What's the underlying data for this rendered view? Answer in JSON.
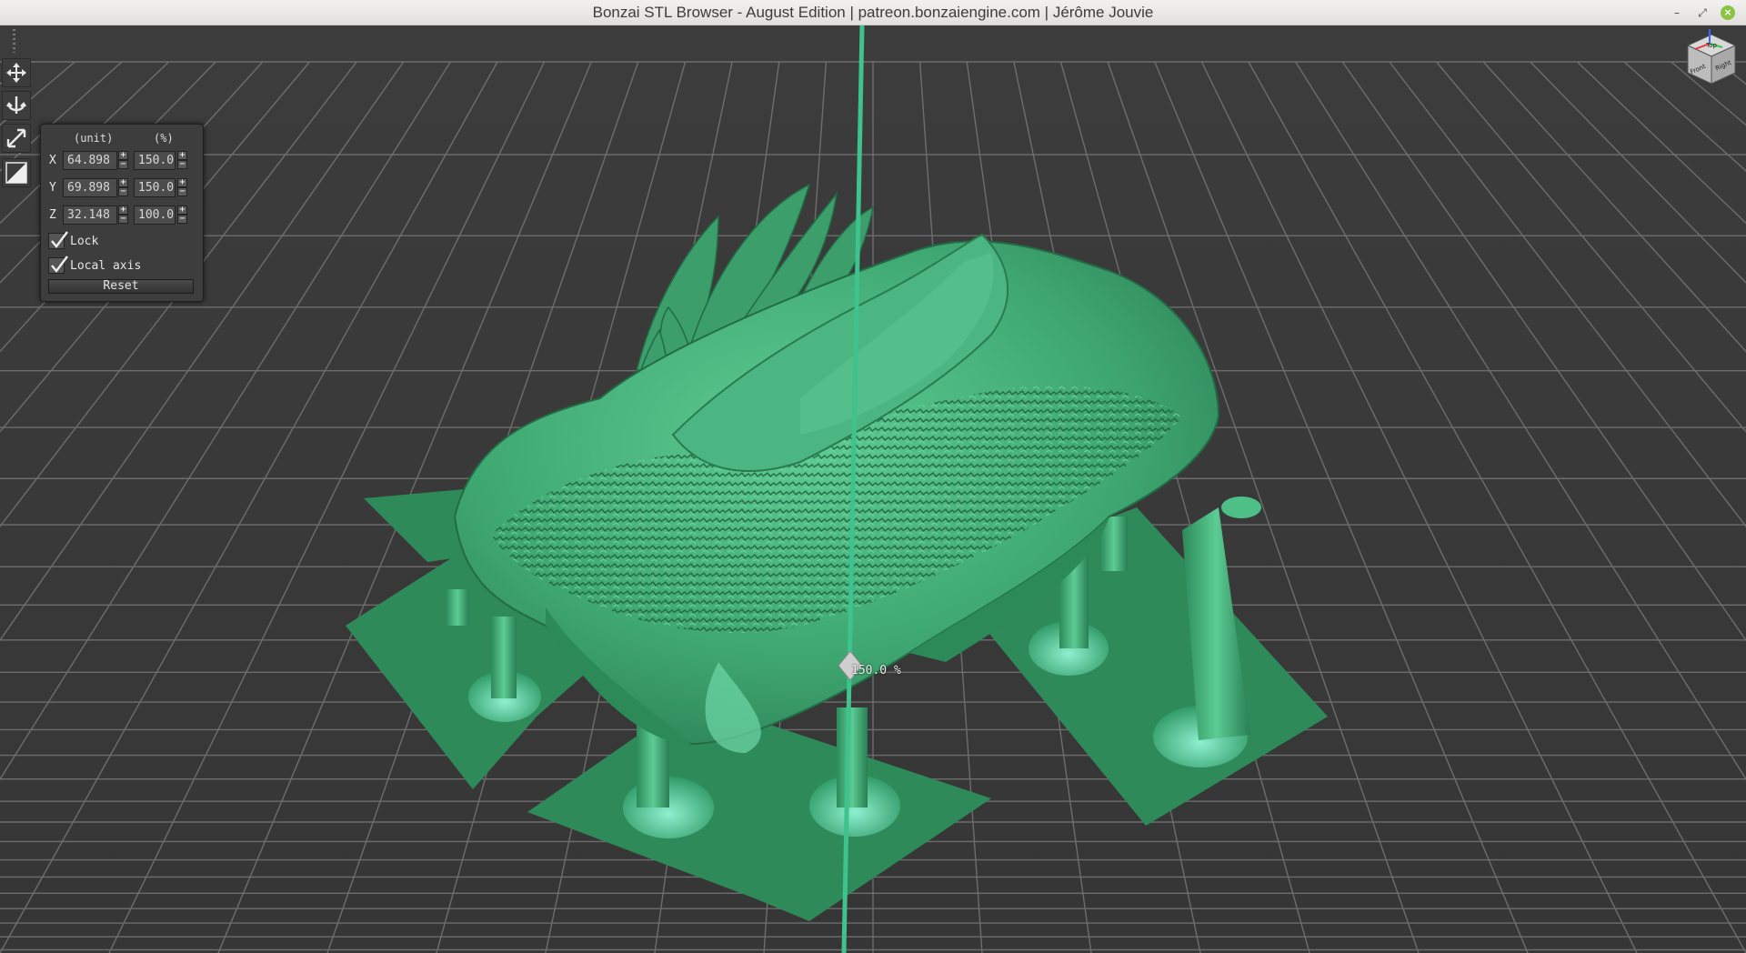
{
  "window": {
    "title": "Bonzai STL Browser - August Edition | patreon.bonzaiengine.com | Jérôme Jouvie",
    "buttons": {
      "minimize": "–",
      "maximize": "⤢",
      "close": "×"
    }
  },
  "toolbar": {
    "tools": [
      {
        "name": "move-tool",
        "icon": "four-way-arrow-icon"
      },
      {
        "name": "rotate-tool",
        "icon": "anchor-icon"
      },
      {
        "name": "scale-tool",
        "icon": "diagonal-resize-icon"
      },
      {
        "name": "plane-cut-tool",
        "icon": "half-square-icon"
      }
    ]
  },
  "scale_panel": {
    "header_unit": "(unit)",
    "header_percent": "(%)",
    "rows": [
      {
        "axis": "X",
        "unit": "64.898",
        "percent": "150.0"
      },
      {
        "axis": "Y",
        "unit": "69.898",
        "percent": "150.0"
      },
      {
        "axis": "Z",
        "unit": "32.148",
        "percent": "100.0"
      }
    ],
    "stepper_plus": "+",
    "stepper_minus": "−",
    "lock_label": "Lock",
    "lock_checked": true,
    "local_axis_label": "Local axis",
    "local_axis_checked": true,
    "reset_label": "Reset"
  },
  "viewport": {
    "gizmo_readout": "150.0 %",
    "model_color": "#3fa872",
    "grid_color": "#6a6a6a",
    "background_color": "#3a3a3a",
    "axis_line_color": "#3ec28e"
  },
  "navcube": {
    "faces": [
      "Top",
      "Front",
      "Right"
    ]
  }
}
